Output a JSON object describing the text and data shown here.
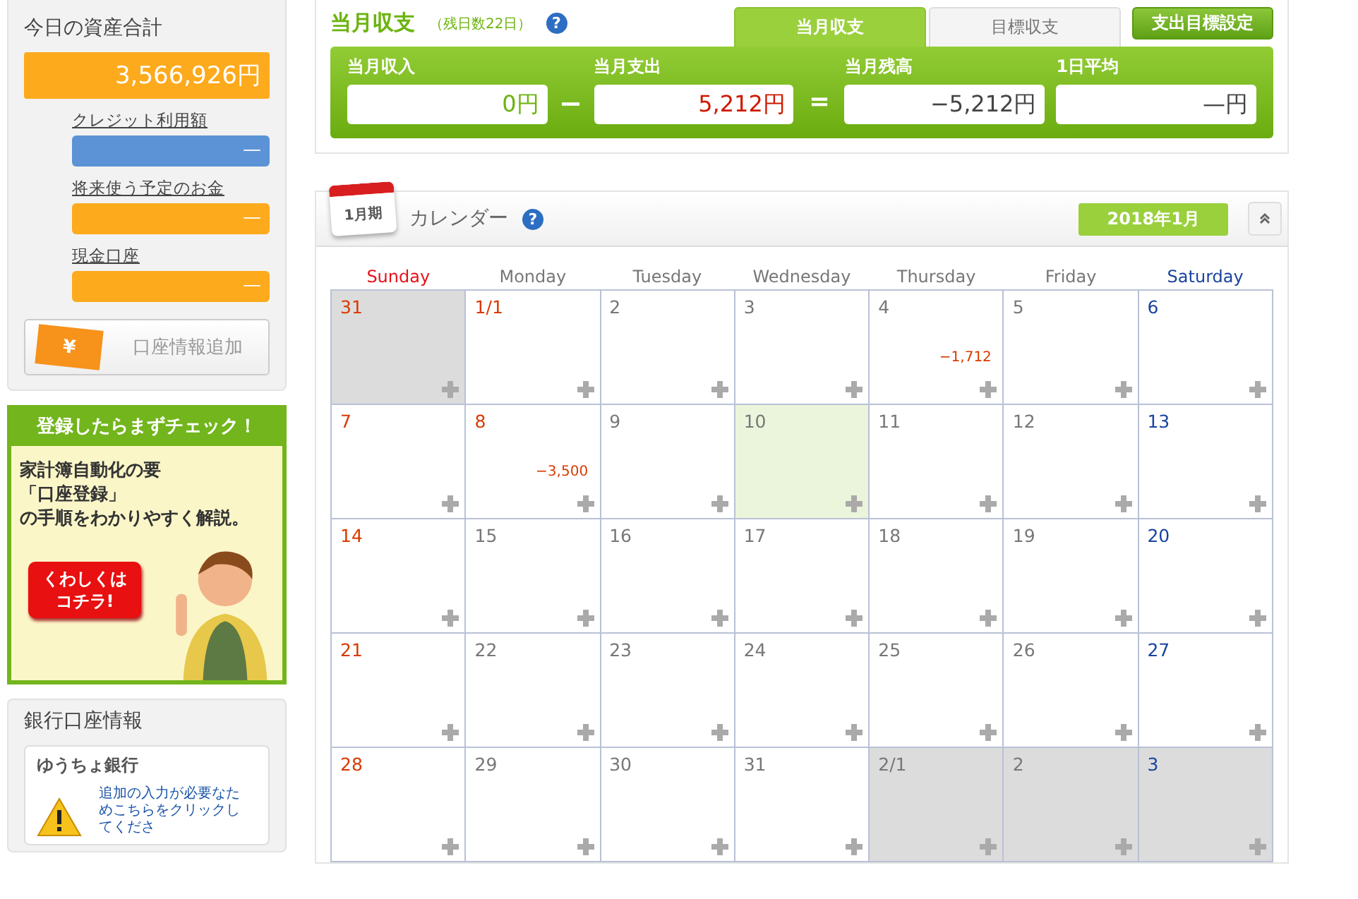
{
  "assets": {
    "title": "今日の資産合計",
    "total": "3,566,926円",
    "items": [
      {
        "label": "クレジット利用額",
        "value": "—",
        "color": "#5b93d6"
      },
      {
        "label": "将来使う予定のお金",
        "value": "—",
        "color": "#fdaa1c"
      },
      {
        "label": "現金口座",
        "value": "—",
        "color": "#fdaa1c"
      }
    ],
    "add_button": {
      "icon": "¥",
      "label": "口座情報追加"
    }
  },
  "banner": {
    "heading": "登録したらまずチェック！",
    "lines": [
      "家計簿自動化の要",
      "「口座登録」",
      "の手順をわかりやすく解説。"
    ],
    "button": [
      "くわしくは",
      "コチラ!"
    ]
  },
  "bank": {
    "title": "銀行口座情報",
    "name": "ゆうちょ銀行",
    "notice": "追加の入力が必要なためこちらをクリックしてくださ"
  },
  "summary": {
    "title": "当月収支",
    "remaining": "（残日数22日）",
    "help": "?",
    "tabs": [
      {
        "label": "当月収支",
        "selected": true
      },
      {
        "label": "目標収支",
        "selected": false
      }
    ],
    "goal_button": "支出目標設定",
    "boxes": [
      {
        "label": "当月収入",
        "value": "0円",
        "kind": "income",
        "op": "−"
      },
      {
        "label": "当月支出",
        "value": "5,212円",
        "kind": "expense",
        "op": "＝"
      },
      {
        "label": "当月残高",
        "value": "−5,212円",
        "kind": "balance"
      },
      {
        "label": "1日平均",
        "value": "—円",
        "kind": "average"
      }
    ]
  },
  "calendar": {
    "badge": "1月期",
    "title": "カレンダー",
    "help": "?",
    "month": "2018年1月",
    "weekdays": [
      {
        "label": "Sunday",
        "kind": "sunday"
      },
      {
        "label": "Monday",
        "kind": "weekday"
      },
      {
        "label": "Tuesday",
        "kind": "weekday"
      },
      {
        "label": "Wednesday",
        "kind": "weekday"
      },
      {
        "label": "Thursday",
        "kind": "weekday"
      },
      {
        "label": "Friday",
        "kind": "weekday"
      },
      {
        "label": "Saturday",
        "kind": "saturday"
      }
    ],
    "days": [
      {
        "day": "31",
        "kind": "holiday",
        "in_month": false,
        "today": false
      },
      {
        "day": "1/1",
        "kind": "holiday",
        "in_month": true,
        "today": false
      },
      {
        "day": "2",
        "kind": "weekday",
        "in_month": true,
        "today": false
      },
      {
        "day": "3",
        "kind": "weekday",
        "in_month": true,
        "today": false
      },
      {
        "day": "4",
        "kind": "weekday",
        "in_month": true,
        "today": false,
        "amount": "−1,712"
      },
      {
        "day": "5",
        "kind": "weekday",
        "in_month": true,
        "today": false
      },
      {
        "day": "6",
        "kind": "saturday",
        "in_month": true,
        "today": false
      },
      {
        "day": "7",
        "kind": "holiday",
        "in_month": true,
        "today": false
      },
      {
        "day": "8",
        "kind": "holiday",
        "in_month": true,
        "today": false,
        "amount": "−3,500"
      },
      {
        "day": "9",
        "kind": "weekday",
        "in_month": true,
        "today": false
      },
      {
        "day": "10",
        "kind": "weekday",
        "in_month": true,
        "today": true
      },
      {
        "day": "11",
        "kind": "weekday",
        "in_month": true,
        "today": false
      },
      {
        "day": "12",
        "kind": "weekday",
        "in_month": true,
        "today": false
      },
      {
        "day": "13",
        "kind": "saturday",
        "in_month": true,
        "today": false
      },
      {
        "day": "14",
        "kind": "holiday",
        "in_month": true,
        "today": false
      },
      {
        "day": "15",
        "kind": "weekday",
        "in_month": true,
        "today": false
      },
      {
        "day": "16",
        "kind": "weekday",
        "in_month": true,
        "today": false
      },
      {
        "day": "17",
        "kind": "weekday",
        "in_month": true,
        "today": false
      },
      {
        "day": "18",
        "kind": "weekday",
        "in_month": true,
        "today": false
      },
      {
        "day": "19",
        "kind": "weekday",
        "in_month": true,
        "today": false
      },
      {
        "day": "20",
        "kind": "saturday",
        "in_month": true,
        "today": false
      },
      {
        "day": "21",
        "kind": "holiday",
        "in_month": true,
        "today": false
      },
      {
        "day": "22",
        "kind": "weekday",
        "in_month": true,
        "today": false
      },
      {
        "day": "23",
        "kind": "weekday",
        "in_month": true,
        "today": false
      },
      {
        "day": "24",
        "kind": "weekday",
        "in_month": true,
        "today": false
      },
      {
        "day": "25",
        "kind": "weekday",
        "in_month": true,
        "today": false
      },
      {
        "day": "26",
        "kind": "weekday",
        "in_month": true,
        "today": false
      },
      {
        "day": "27",
        "kind": "saturday",
        "in_month": true,
        "today": false
      },
      {
        "day": "28",
        "kind": "holiday",
        "in_month": true,
        "today": false
      },
      {
        "day": "29",
        "kind": "weekday",
        "in_month": true,
        "today": false
      },
      {
        "day": "30",
        "kind": "weekday",
        "in_month": true,
        "today": false
      },
      {
        "day": "31",
        "kind": "weekday",
        "in_month": true,
        "today": false
      },
      {
        "day": "2/1",
        "kind": "weekday",
        "in_month": false,
        "today": false
      },
      {
        "day": "2",
        "kind": "weekday",
        "in_month": false,
        "today": false
      },
      {
        "day": "3",
        "kind": "saturday",
        "in_month": false,
        "today": false
      }
    ]
  }
}
